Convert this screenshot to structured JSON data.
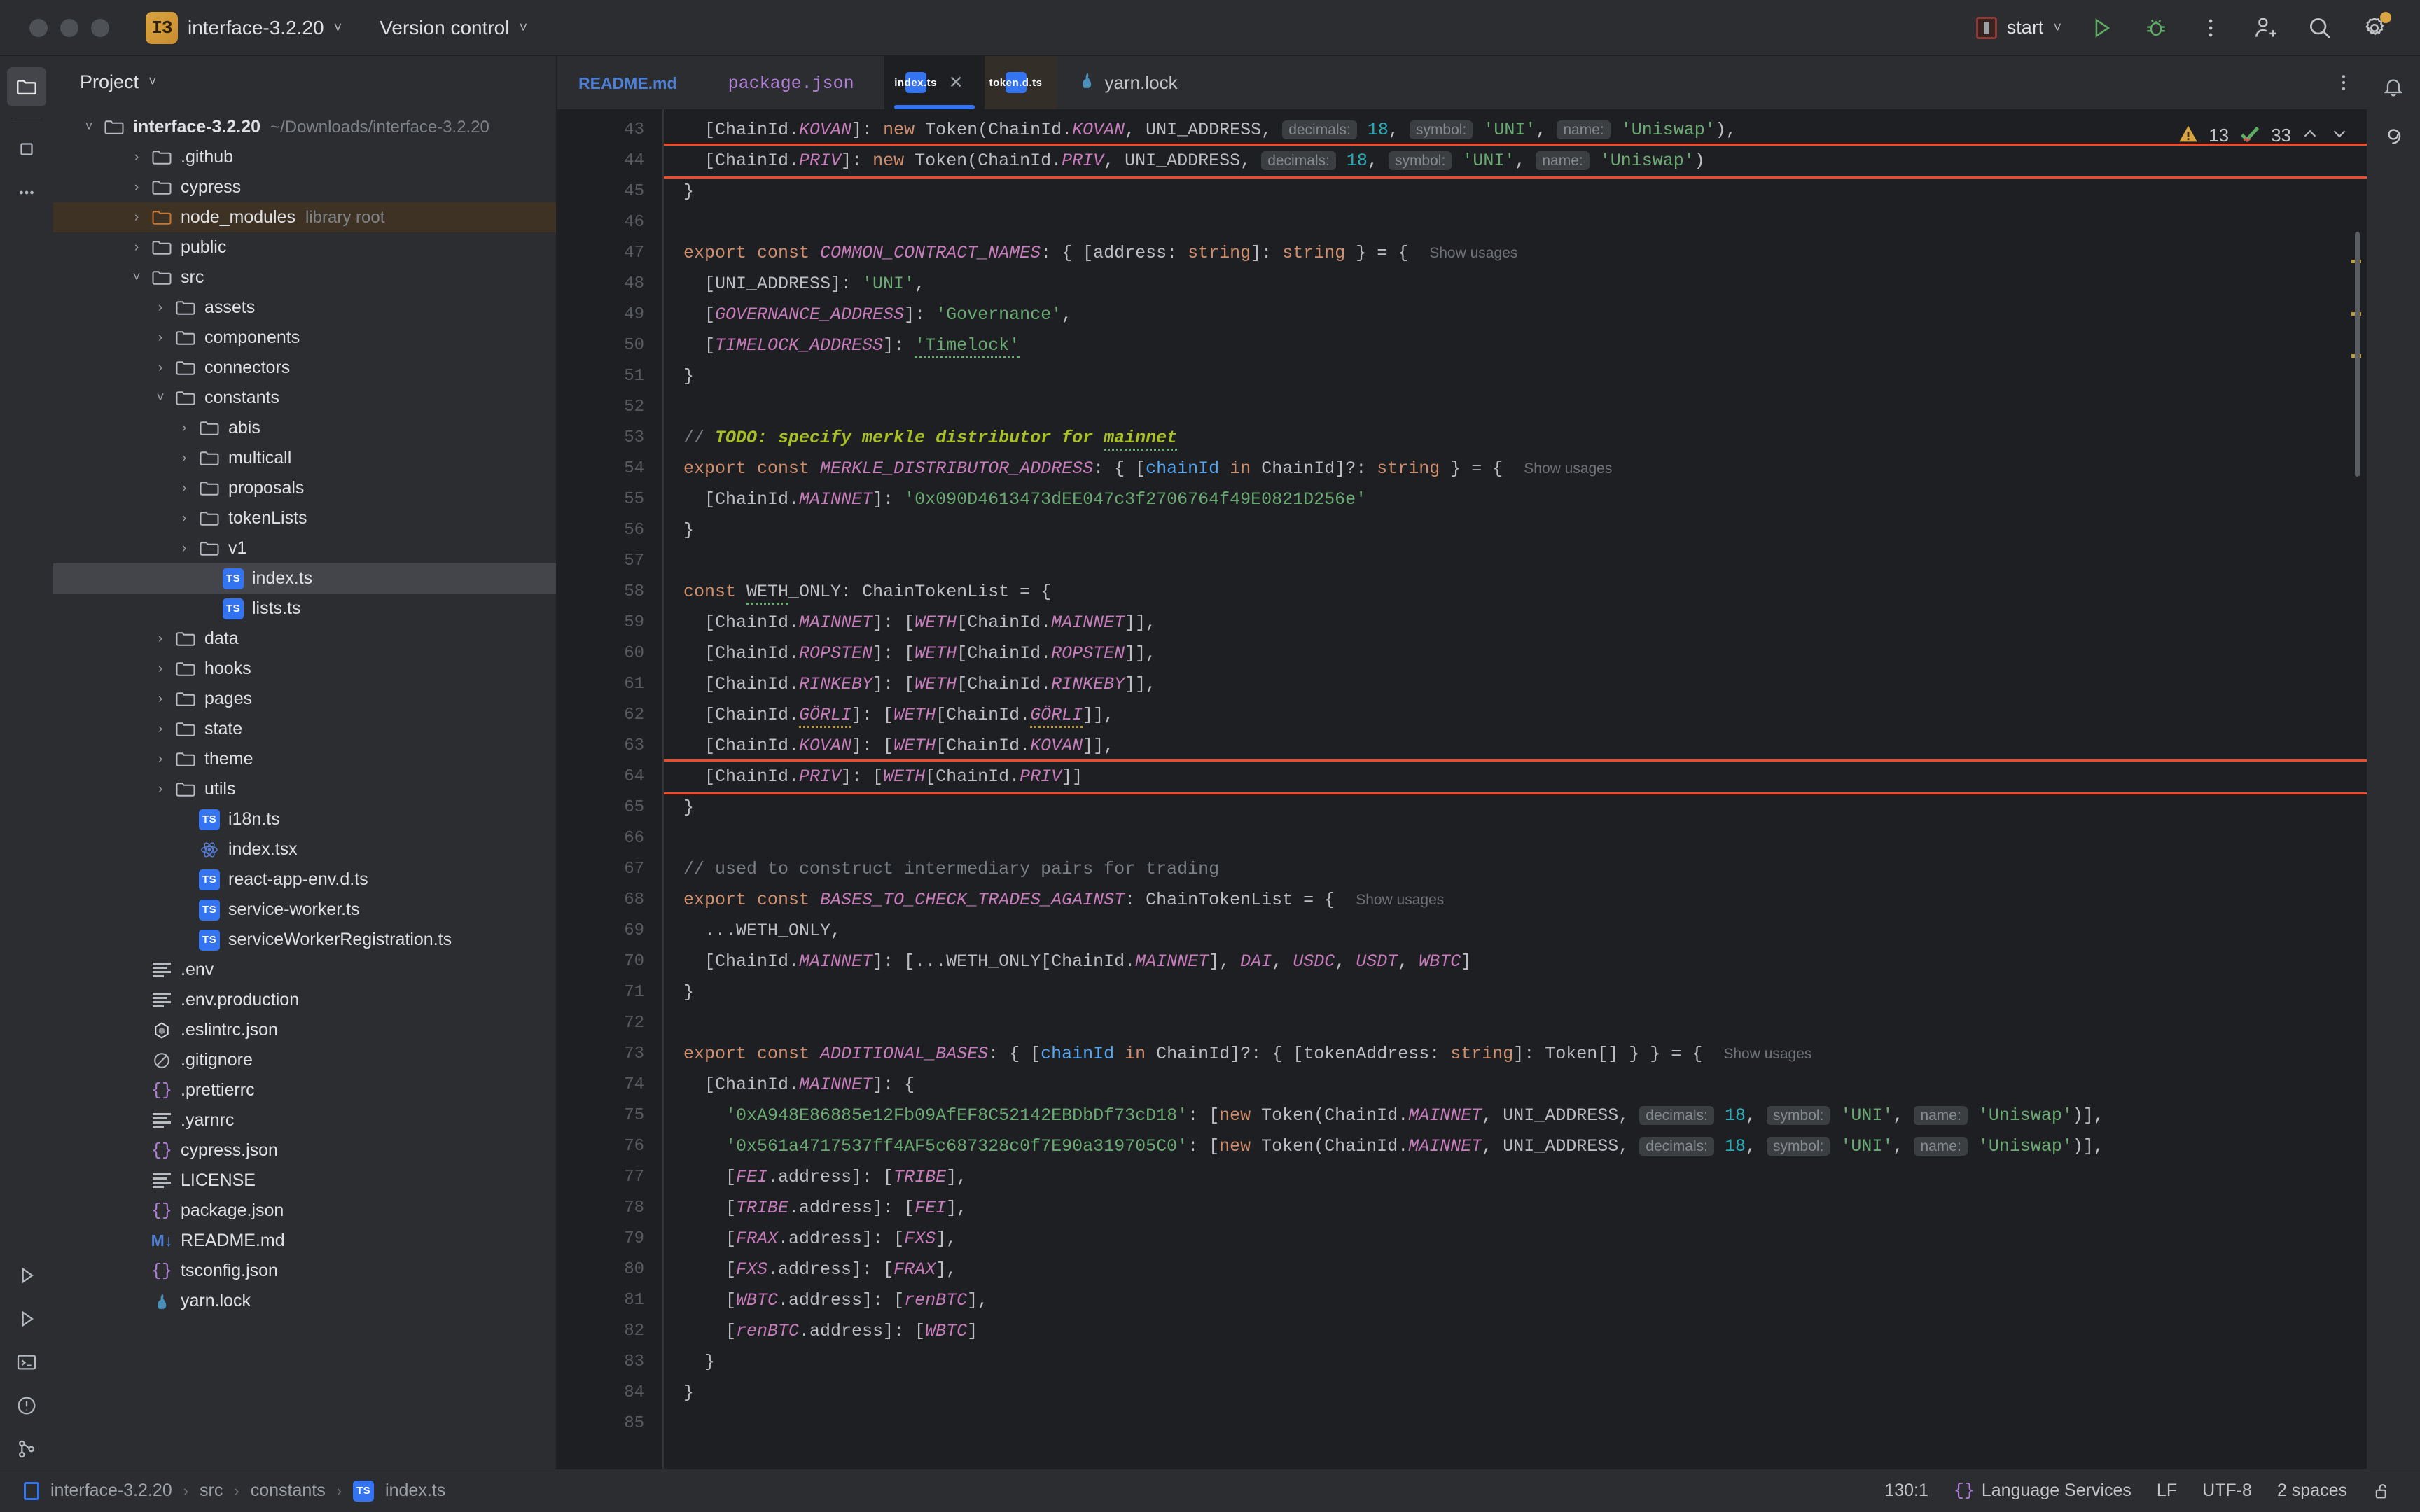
{
  "titlebar": {
    "project_badge": "I3",
    "project_name": "interface-3.2.20",
    "vcs_label": "Version control",
    "run_config": "start",
    "icons": [
      "run-icon",
      "debug-icon",
      "more-options-icon",
      "add-account-icon",
      "search-icon",
      "settings-icon"
    ]
  },
  "project_tool": {
    "title": "Project",
    "root": {
      "label": "interface-3.2.20",
      "path": "~/Downloads/interface-3.2.20"
    },
    "items": [
      {
        "label": ".github",
        "indent": 2,
        "icon": "folder",
        "arrow": "right"
      },
      {
        "label": "cypress",
        "indent": 2,
        "icon": "folder",
        "arrow": "right"
      },
      {
        "label": "node_modules",
        "indent": 2,
        "icon": "folder-orange",
        "arrow": "right",
        "badge": "library root",
        "state": "library"
      },
      {
        "label": "public",
        "indent": 2,
        "icon": "folder",
        "arrow": "right"
      },
      {
        "label": "src",
        "indent": 2,
        "icon": "folder",
        "arrow": "down"
      },
      {
        "label": "assets",
        "indent": 3,
        "icon": "folder",
        "arrow": "right"
      },
      {
        "label": "components",
        "indent": 3,
        "icon": "folder",
        "arrow": "right"
      },
      {
        "label": "connectors",
        "indent": 3,
        "icon": "folder",
        "arrow": "right"
      },
      {
        "label": "constants",
        "indent": 3,
        "icon": "folder",
        "arrow": "down"
      },
      {
        "label": "abis",
        "indent": 4,
        "icon": "folder",
        "arrow": "right"
      },
      {
        "label": "multicall",
        "indent": 4,
        "icon": "folder",
        "arrow": "right"
      },
      {
        "label": "proposals",
        "indent": 4,
        "icon": "folder",
        "arrow": "right"
      },
      {
        "label": "tokenLists",
        "indent": 4,
        "icon": "folder",
        "arrow": "right"
      },
      {
        "label": "v1",
        "indent": 4,
        "icon": "folder",
        "arrow": "right"
      },
      {
        "label": "index.ts",
        "indent": 5,
        "icon": "ts",
        "arrow": "none",
        "state": "selected"
      },
      {
        "label": "lists.ts",
        "indent": 5,
        "icon": "ts",
        "arrow": "none"
      },
      {
        "label": "data",
        "indent": 3,
        "icon": "folder",
        "arrow": "right"
      },
      {
        "label": "hooks",
        "indent": 3,
        "icon": "folder",
        "arrow": "right"
      },
      {
        "label": "pages",
        "indent": 3,
        "icon": "folder",
        "arrow": "right"
      },
      {
        "label": "state",
        "indent": 3,
        "icon": "folder",
        "arrow": "right"
      },
      {
        "label": "theme",
        "indent": 3,
        "icon": "folder",
        "arrow": "right"
      },
      {
        "label": "utils",
        "indent": 3,
        "icon": "folder",
        "arrow": "right"
      },
      {
        "label": "i18n.ts",
        "indent": 4,
        "icon": "ts",
        "arrow": "none"
      },
      {
        "label": "index.tsx",
        "indent": 4,
        "icon": "react",
        "arrow": "none"
      },
      {
        "label": "react-app-env.d.ts",
        "indent": 4,
        "icon": "ts",
        "arrow": "none"
      },
      {
        "label": "service-worker.ts",
        "indent": 4,
        "icon": "ts",
        "arrow": "none"
      },
      {
        "label": "serviceWorkerRegistration.ts",
        "indent": 4,
        "icon": "ts",
        "arrow": "none"
      },
      {
        "label": ".env",
        "indent": 2,
        "icon": "text",
        "arrow": "none"
      },
      {
        "label": ".env.production",
        "indent": 2,
        "icon": "text",
        "arrow": "none"
      },
      {
        "label": ".eslintrc.json",
        "indent": 2,
        "icon": "eslint",
        "arrow": "none"
      },
      {
        "label": ".gitignore",
        "indent": 2,
        "icon": "ignore",
        "arrow": "none"
      },
      {
        "label": ".prettierrc",
        "indent": 2,
        "icon": "json",
        "arrow": "none"
      },
      {
        "label": ".yarnrc",
        "indent": 2,
        "icon": "text",
        "arrow": "none"
      },
      {
        "label": "cypress.json",
        "indent": 2,
        "icon": "json",
        "arrow": "none"
      },
      {
        "label": "LICENSE",
        "indent": 2,
        "icon": "text",
        "arrow": "none"
      },
      {
        "label": "package.json",
        "indent": 2,
        "icon": "json",
        "arrow": "none"
      },
      {
        "label": "README.md",
        "indent": 2,
        "icon": "md",
        "arrow": "none"
      },
      {
        "label": "tsconfig.json",
        "indent": 2,
        "icon": "json",
        "arrow": "none"
      },
      {
        "label": "yarn.lock",
        "indent": 2,
        "icon": "yarn",
        "arrow": "none"
      }
    ]
  },
  "tabs": [
    {
      "label": "README.md",
      "icon": "md",
      "state": "normal"
    },
    {
      "label": "package.json",
      "icon": "json",
      "state": "normal"
    },
    {
      "label": "index.ts",
      "icon": "ts",
      "state": "active",
      "closable": true
    },
    {
      "label": "token.d.ts",
      "icon": "ts",
      "state": "hovered"
    },
    {
      "label": "yarn.lock",
      "icon": "yarn",
      "state": "normal"
    }
  ],
  "inspection": {
    "warning_count": "13",
    "ok_count": "33",
    "prev_label": "prev-problem",
    "next_label": "next-problem"
  },
  "editor": {
    "first_line": 43,
    "highlighted_lines": [
      44,
      64
    ],
    "lines": [
      {
        "n": 43,
        "html": "  [ChainId.<i>KOVAN</i>]: <k>new</k> Token(ChainId.<i>KOVAN</i>, UNI_ADDRESS, <h>decimals:</h> <num>18</num>, <h>symbol:</h> <s>'UNI'</s>, <h>name:</h> <s>'Uniswap'</s>),"
      },
      {
        "n": 44,
        "html": "  [ChainId.<i>PRIV</i>]: <k>new</k> Token(ChainId.<i>PRIV</i>, UNI_ADDRESS, <h>decimals:</h> <num>18</num>, <h>symbol:</h> <s>'UNI'</s>, <h>name:</h> <s>'Uniswap'</s>)"
      },
      {
        "n": 45,
        "html": "}"
      },
      {
        "n": 46,
        "html": ""
      },
      {
        "n": 47,
        "html": "<k>export const</k> <i>COMMON_CONTRACT_NAMES</i>: { [address: <k>string</k>]: <k>string</k> } = {  <u>Show usages</u>"
      },
      {
        "n": 48,
        "html": "  [UNI_ADDRESS]: <s>'UNI'</s>,"
      },
      {
        "n": 49,
        "html": "  [<i>GOVERNANCE_ADDRESS</i>]: <s>'Governance'</s>,"
      },
      {
        "n": 50,
        "html": "  [<i>TIMELOCK_ADDRESS</i>]: <s><w>'Timelock'</w></s>"
      },
      {
        "n": 51,
        "html": "}"
      },
      {
        "n": 52,
        "html": ""
      },
      {
        "n": 53,
        "html": "<cm>// </cm><td>TODO: specify merkle distributor for <w>mainnet</w></td>"
      },
      {
        "n": 54,
        "html": "<k>export const</k> <i>MERKLE_DISTRIBUTOR_ADDRESS</i>: { [<p>chainId</p> <k>in</k> ChainId]?: <k>string</k> } = {  <u>Show usages</u>"
      },
      {
        "n": 55,
        "html": "  [ChainId.<i>MAINNET</i>]: <s>'0x090D4613473dEE047c3f2706764f49E0821D256e'</s>"
      },
      {
        "n": 56,
        "html": "}"
      },
      {
        "n": 57,
        "html": ""
      },
      {
        "n": 58,
        "html": "<k>const</k> <w>WETH</w>_ONLY: ChainTokenList = {"
      },
      {
        "n": 59,
        "html": "  [ChainId.<i>MAINNET</i>]: [<i>WETH</i>[ChainId.<i>MAINNET</i>]],"
      },
      {
        "n": 60,
        "html": "  [ChainId.<i>ROPSTEN</i>]: [<i>WETH</i>[ChainId.<i>ROPSTEN</i>]],"
      },
      {
        "n": 61,
        "html": "  [ChainId.<i>RINKEBY</i>]: [<i>WETH</i>[ChainId.<i>RINKEBY</i>]],"
      },
      {
        "n": 62,
        "html": "  [ChainId.<i><y>GÖRLI</y></i>]: [<i>WETH</i>[ChainId.<i><y>GÖRLI</y></i>]],"
      },
      {
        "n": 63,
        "html": "  [ChainId.<i>KOVAN</i>]: [<i>WETH</i>[ChainId.<i>KOVAN</i>]],"
      },
      {
        "n": 64,
        "html": "  [ChainId.<i>PRIV</i>]: [<i>WETH</i>[ChainId.<i>PRIV</i>]]"
      },
      {
        "n": 65,
        "html": "}"
      },
      {
        "n": 66,
        "html": ""
      },
      {
        "n": 67,
        "html": "<cm>// used to construct intermediary pairs for trading</cm>"
      },
      {
        "n": 68,
        "html": "<k>export const</k> <i>BASES_TO_CHECK_TRADES_AGAINST</i>: ChainTokenList = {  <u>Show usages</u>"
      },
      {
        "n": 69,
        "html": "  ...WETH_ONLY,"
      },
      {
        "n": 70,
        "html": "  [ChainId.<i>MAINNET</i>]: [...WETH_ONLY[ChainId.<i>MAINNET</i>], <i>DAI</i>, <i>USDC</i>, <i>USDT</i>, <i>WBTC</i>]"
      },
      {
        "n": 71,
        "html": "}"
      },
      {
        "n": 72,
        "html": ""
      },
      {
        "n": 73,
        "html": "<k>export const</k> <i>ADDITIONAL_BASES</i>: { [<p>chainId</p> <k>in</k> ChainId]?: { [tokenAddress: <k>string</k>]: Token[] } } = {  <u>Show usages</u>"
      },
      {
        "n": 74,
        "html": "  [ChainId.<i>MAINNET</i>]: {"
      },
      {
        "n": 75,
        "html": "    <s>'0xA948E86885e12Fb09AfEF8C52142EBDbDf73cD18'</s>: [<k>new</k> Token(ChainId.<i>MAINNET</i>, UNI_ADDRESS, <h>decimals:</h> <num>18</num>, <h>symbol:</h> <s>'UNI'</s>, <h>name:</h> <s>'Uniswap'</s>)],"
      },
      {
        "n": 76,
        "html": "    <s>'0x561a4717537ff4AF5c687328c0f7E90a319705C0'</s>: [<k>new</k> Token(ChainId.<i>MAINNET</i>, UNI_ADDRESS, <h>decimals:</h> <num>18</num>, <h>symbol:</h> <s>'UNI'</s>, <h>name:</h> <s>'Uniswap'</s>)],"
      },
      {
        "n": 77,
        "html": "    [<i>FEI</i>.address]: [<i>TRIBE</i>],"
      },
      {
        "n": 78,
        "html": "    [<i>TRIBE</i>.address]: [<i>FEI</i>],"
      },
      {
        "n": 79,
        "html": "    [<i>FRAX</i>.address]: [<i>FXS</i>],"
      },
      {
        "n": 80,
        "html": "    [<i>FXS</i>.address]: [<i>FRAX</i>],"
      },
      {
        "n": 81,
        "html": "    [<i>WBTC</i>.address]: [<i>renBTC</i>],"
      },
      {
        "n": 82,
        "html": "    [<i>renBTC</i>.address]: [<i>WBTC</i>]"
      },
      {
        "n": 83,
        "html": "  }"
      },
      {
        "n": 84,
        "html": "}"
      },
      {
        "n": 85,
        "html": ""
      }
    ]
  },
  "status_bar": {
    "breadcrumbs": [
      "interface-3.2.20",
      "src",
      "constants",
      "index.ts"
    ],
    "caret": "130:1",
    "language_services": "Language Services",
    "line_separator": "LF",
    "encoding": "UTF-8",
    "indent": "2 spaces",
    "lock": "unlocked-icon"
  },
  "colors": {
    "accent_blue": "#3574f0",
    "highlight_red": "#f04a2b",
    "warning_yellow": "#d9a441",
    "ok_green": "#6aab73",
    "string_green": "#6aab73",
    "keyword_orange": "#cf8e6d",
    "italic_purple": "#c77dbb",
    "number_teal": "#2aacb8"
  }
}
